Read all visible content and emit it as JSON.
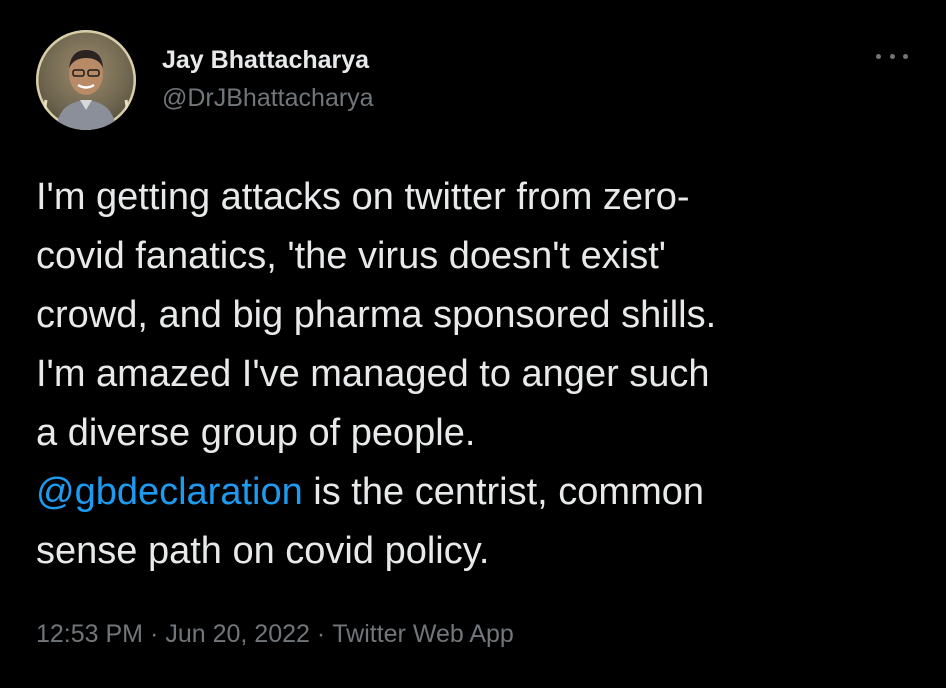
{
  "author": {
    "display_name": "Jay Bhattacharya",
    "handle": "@DrJBhattacharya",
    "avatar_icon": "profile-photo"
  },
  "tweet": {
    "lines": [
      "I'm getting attacks on twitter from zero-",
      "covid fanatics, 'the virus doesn't exist'",
      "crowd, and big pharma sponsored shills.",
      "I'm amazed I've managed to anger such",
      "a diverse group of people."
    ],
    "mention": "@gbdeclaration",
    "mention_line_rest": " is the centrist, common",
    "last_line": "sense path on covid policy."
  },
  "meta": {
    "time": "12:53 PM",
    "separator": "·",
    "date": "Jun 20, 2022",
    "source": "Twitter Web App"
  },
  "colors": {
    "background": "#000000",
    "text": "#e7e9ea",
    "secondary": "#71767b",
    "link": "#1d9bf0"
  },
  "icons": {
    "more": "more-options-icon"
  }
}
